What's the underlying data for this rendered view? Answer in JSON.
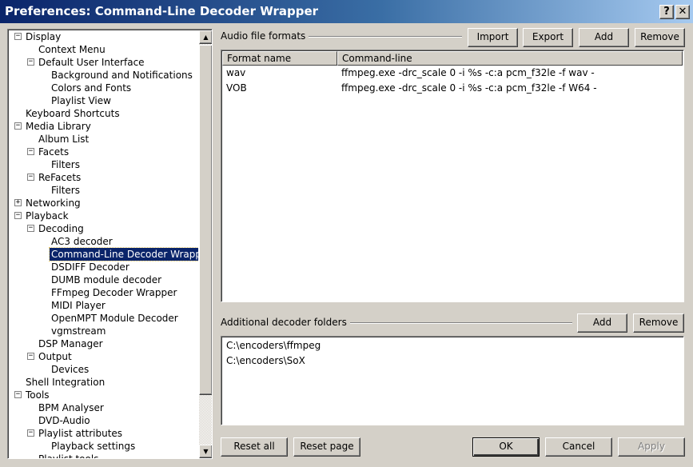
{
  "window": {
    "title": "Preferences: Command-Line Decoder Wrapper",
    "help_glyph": "?",
    "close_glyph": "✕"
  },
  "tree": {
    "expanded_glyph": "−",
    "collapsed_glyph": "+",
    "items": [
      {
        "label": "Display",
        "level": 0,
        "expander": "expanded"
      },
      {
        "label": "Context Menu",
        "level": 1,
        "expander": "none"
      },
      {
        "label": "Default User Interface",
        "level": 1,
        "expander": "expanded"
      },
      {
        "label": "Background and Notifications",
        "level": 2,
        "expander": "none"
      },
      {
        "label": "Colors and Fonts",
        "level": 2,
        "expander": "none"
      },
      {
        "label": "Playlist View",
        "level": 2,
        "expander": "none"
      },
      {
        "label": "Keyboard Shortcuts",
        "level": 0,
        "expander": "none"
      },
      {
        "label": "Media Library",
        "level": 0,
        "expander": "expanded"
      },
      {
        "label": "Album List",
        "level": 1,
        "expander": "none"
      },
      {
        "label": "Facets",
        "level": 1,
        "expander": "expanded"
      },
      {
        "label": "Filters",
        "level": 2,
        "expander": "none"
      },
      {
        "label": "ReFacets",
        "level": 1,
        "expander": "expanded"
      },
      {
        "label": "Filters",
        "level": 2,
        "expander": "none"
      },
      {
        "label": "Networking",
        "level": 0,
        "expander": "collapsed"
      },
      {
        "label": "Playback",
        "level": 0,
        "expander": "expanded"
      },
      {
        "label": "Decoding",
        "level": 1,
        "expander": "expanded"
      },
      {
        "label": "AC3 decoder",
        "level": 2,
        "expander": "none"
      },
      {
        "label": "Command-Line Decoder Wrapper",
        "level": 2,
        "expander": "none",
        "selected": true
      },
      {
        "label": "DSDIFF Decoder",
        "level": 2,
        "expander": "none"
      },
      {
        "label": "DUMB module decoder",
        "level": 2,
        "expander": "none"
      },
      {
        "label": "FFmpeg Decoder Wrapper",
        "level": 2,
        "expander": "none"
      },
      {
        "label": "MIDI Player",
        "level": 2,
        "expander": "none"
      },
      {
        "label": "OpenMPT Module Decoder",
        "level": 2,
        "expander": "none"
      },
      {
        "label": "vgmstream",
        "level": 2,
        "expander": "none"
      },
      {
        "label": "DSP Manager",
        "level": 1,
        "expander": "none"
      },
      {
        "label": "Output",
        "level": 1,
        "expander": "expanded"
      },
      {
        "label": "Devices",
        "level": 2,
        "expander": "none"
      },
      {
        "label": "Shell Integration",
        "level": 0,
        "expander": "none"
      },
      {
        "label": "Tools",
        "level": 0,
        "expander": "expanded"
      },
      {
        "label": "BPM Analyser",
        "level": 1,
        "expander": "none"
      },
      {
        "label": "DVD-Audio",
        "level": 1,
        "expander": "none"
      },
      {
        "label": "Playlist attributes",
        "level": 1,
        "expander": "expanded"
      },
      {
        "label": "Playback settings",
        "level": 2,
        "expander": "none"
      },
      {
        "label": "Playlist tools",
        "level": 1,
        "expander": "none"
      }
    ],
    "scroll_up_glyph": "▲",
    "scroll_down_glyph": "▼"
  },
  "formats": {
    "group_label": "Audio file formats",
    "import_label": "Import",
    "export_label": "Export",
    "add_label": "Add",
    "remove_label": "Remove",
    "columns": [
      "Format name",
      "Command-line"
    ],
    "rows": [
      {
        "name": "wav",
        "command": "ffmpeg.exe -drc_scale 0 -i %s -c:a pcm_f32le -f wav -"
      },
      {
        "name": "VOB",
        "command": "ffmpeg.exe -drc_scale 0 -i %s -c:a pcm_f32le -f W64 -"
      }
    ]
  },
  "folders": {
    "group_label": "Additional decoder folders",
    "add_label": "Add",
    "remove_label": "Remove",
    "items": [
      "C:\\encoders\\ffmpeg",
      "C:\\encoders\\SoX"
    ]
  },
  "footer": {
    "reset_all_label": "Reset all",
    "reset_page_label": "Reset page",
    "ok_label": "OK",
    "cancel_label": "Cancel",
    "apply_label": "Apply"
  }
}
